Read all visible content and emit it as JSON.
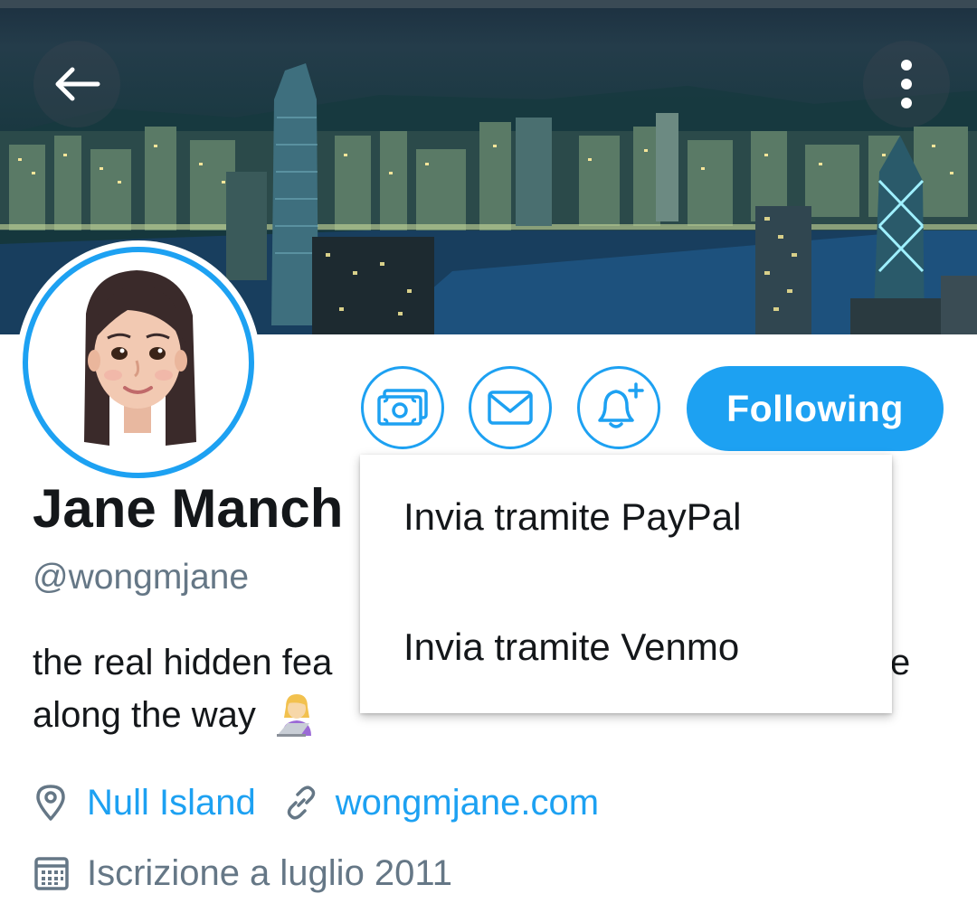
{
  "header": {
    "back_icon": "arrow-left-icon",
    "more_icon": "more-vertical-icon"
  },
  "profile": {
    "name": "Jane Manch",
    "handle": "@wongmjane",
    "bio_line1": "the real hidden fea",
    "bio_line1_tail": "e",
    "bio_line2": "along the way",
    "bio_emoji": "👩‍💻",
    "location": "Null Island",
    "website": "wongmjane.com",
    "joined": "Iscrizione a luglio 2011"
  },
  "actions": {
    "tip_icon": "money-icon",
    "message_icon": "mail-icon",
    "notify_icon": "bell-plus-icon",
    "following_label": "Following"
  },
  "dropdown": {
    "items": [
      {
        "label": "Invia tramite PayPal"
      },
      {
        "label": "Invia tramite Venmo"
      }
    ]
  },
  "colors": {
    "accent": "#1da1f2",
    "text": "#14171a",
    "secondary_text": "#657786"
  }
}
